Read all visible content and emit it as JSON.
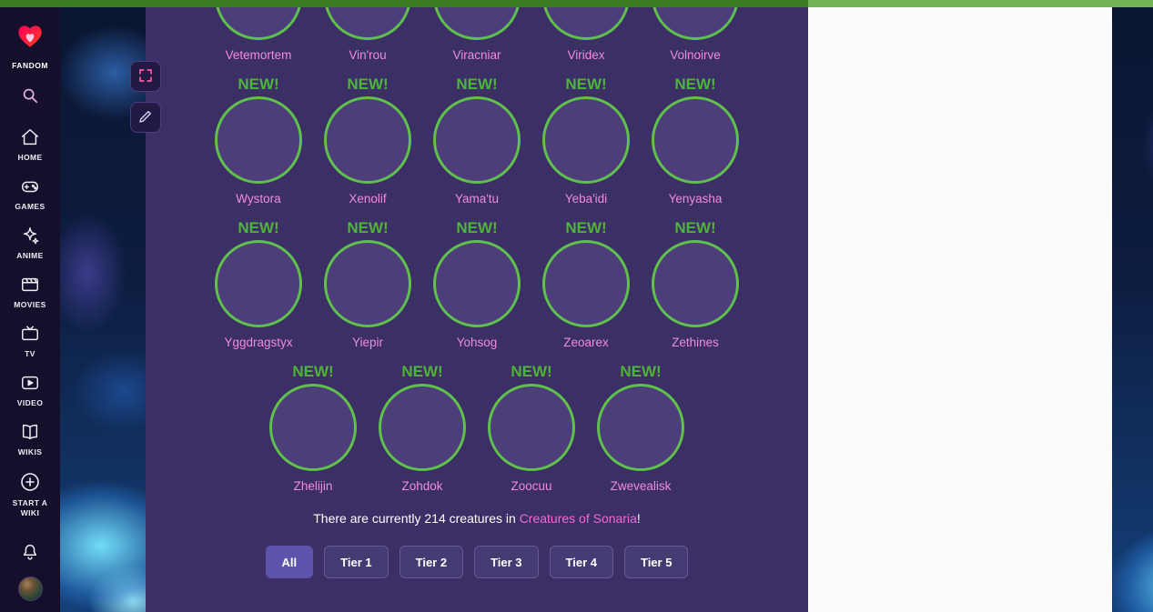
{
  "colors": {
    "topbar_left": "#3a7a20",
    "topbar_right": "#72b356",
    "content_background": "#3c2f66",
    "sidebar_background": "#150f2b",
    "new_badge_green": "#4db536",
    "circle_border_green": "#5fc14c",
    "creature_link_pink": "#f08bdf",
    "active_filter_purple": "#5d53ab"
  },
  "sidebar": {
    "logo_label": "FANDOM",
    "items": [
      {
        "label": "HOME",
        "icon": "home-icon"
      },
      {
        "label": "GAMES",
        "icon": "games-icon"
      },
      {
        "label": "ANIME",
        "icon": "anime-icon"
      },
      {
        "label": "MOVIES",
        "icon": "movies-icon"
      },
      {
        "label": "TV",
        "icon": "tv-icon"
      },
      {
        "label": "VIDEO",
        "icon": "video-icon"
      },
      {
        "label": "WIKIS",
        "icon": "wikis-icon"
      }
    ],
    "start_wiki_label": "START A WIKI"
  },
  "content": {
    "new_label": "NEW!",
    "rows": [
      {
        "clipped": true,
        "items": [
          {
            "name": "Vetemortem",
            "new": false
          },
          {
            "name": "Vin'rou",
            "new": false
          },
          {
            "name": "Viracniar",
            "new": false
          },
          {
            "name": "Viridex",
            "new": false
          },
          {
            "name": "Volnoirve",
            "new": false
          }
        ]
      },
      {
        "clipped": false,
        "items": [
          {
            "name": "Wystora",
            "new": true
          },
          {
            "name": "Xenolif",
            "new": true
          },
          {
            "name": "Yama'tu",
            "new": true
          },
          {
            "name": "Yeba'idi",
            "new": true
          },
          {
            "name": "Yenyasha",
            "new": true
          }
        ]
      },
      {
        "clipped": false,
        "items": [
          {
            "name": "Yggdragstyx",
            "new": true
          },
          {
            "name": "Yiepir",
            "new": true
          },
          {
            "name": "Yohsog",
            "new": true
          },
          {
            "name": "Zeoarex",
            "new": true
          },
          {
            "name": "Zethines",
            "new": true
          }
        ]
      },
      {
        "clipped": false,
        "items": [
          {
            "name": "Zhelijin",
            "new": true
          },
          {
            "name": "Zohdok",
            "new": true
          },
          {
            "name": "Zoocuu",
            "new": true
          },
          {
            "name": "Zwevealisk",
            "new": true
          }
        ]
      }
    ],
    "summary": {
      "prefix": "There are currently 214 creatures in ",
      "link": "Creatures of Sonaria",
      "suffix": "!"
    },
    "filters": [
      {
        "label": "All",
        "active": true
      },
      {
        "label": "Tier 1",
        "active": false
      },
      {
        "label": "Tier 2",
        "active": false
      },
      {
        "label": "Tier 3",
        "active": false
      },
      {
        "label": "Tier 4",
        "active": false
      },
      {
        "label": "Tier 5",
        "active": false
      }
    ]
  }
}
